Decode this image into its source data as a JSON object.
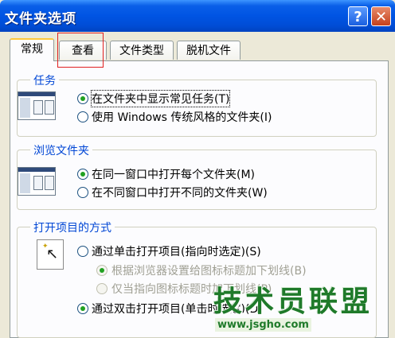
{
  "window": {
    "title": "文件夹选项",
    "help_glyph": "?",
    "close_glyph": "✕"
  },
  "tabs": [
    "常规",
    "查看",
    "文件类型",
    "脱机文件"
  ],
  "groups": {
    "tasks": {
      "title": "任务",
      "options": [
        "在文件夹中显示常见任务(T)",
        "使用 Windows 传统风格的文件夹(I)"
      ]
    },
    "browse": {
      "title": "浏览文件夹",
      "options": [
        "在同一窗口中打开每个文件夹(M)",
        "在不同窗口中打开不同的文件夹(W)"
      ]
    },
    "click": {
      "title": "打开项目的方式",
      "options": [
        "通过单击打开项目(指向时选定)(S)",
        "根据浏览器设置给图标标题加下划线(B)",
        "仅当指向图标标题时加下划线(P)",
        "通过双击打开项目(单击时选定)(D)"
      ]
    }
  },
  "watermark": {
    "text": "技术员联盟",
    "url": "www.jsgho.com"
  },
  "colors": {
    "accent": "#0054e3",
    "group_title": "#0046d5",
    "highlight": "#e02020",
    "radio_dot": "#21a121"
  }
}
